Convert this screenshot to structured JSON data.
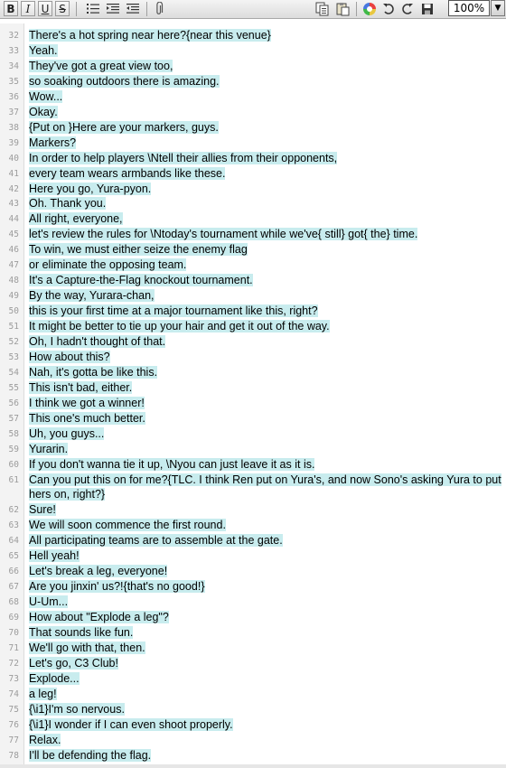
{
  "toolbar": {
    "buttons": [
      {
        "name": "bold-button",
        "icon": "bold-icon",
        "glyph": "B"
      },
      {
        "name": "italic-button",
        "icon": "italic-icon",
        "glyph": "I"
      },
      {
        "name": "underline-button",
        "icon": "underline-icon",
        "glyph": "U"
      },
      {
        "name": "strikeout-button",
        "icon": "strikeout-icon",
        "glyph": "S"
      },
      {
        "name": "list-button",
        "icon": "list-icon"
      },
      {
        "name": "indent-button",
        "icon": "indent-icon"
      },
      {
        "name": "outdent-button",
        "icon": "outdent-icon"
      },
      {
        "name": "attach-button",
        "icon": "paperclip-icon"
      },
      {
        "name": "copy-button",
        "icon": "copy-icon"
      },
      {
        "name": "paste-button",
        "icon": "paste-icon"
      },
      {
        "name": "color-button",
        "icon": "color-wheel-icon"
      },
      {
        "name": "undo-button",
        "icon": "undo-icon"
      },
      {
        "name": "redo-button",
        "icon": "redo-icon"
      },
      {
        "name": "save-button",
        "icon": "save-icon"
      }
    ],
    "zoom": "100%"
  },
  "colors": {
    "highlight": "#c8ecee",
    "line_number": "#9b9b9b"
  },
  "lines": [
    {
      "n": "32",
      "t": "There's a hot spring near here?{near this venue}"
    },
    {
      "n": "33",
      "t": "Yeah."
    },
    {
      "n": "34",
      "t": "They've got a great view too,"
    },
    {
      "n": "35",
      "t": "so soaking outdoors there is amazing."
    },
    {
      "n": "36",
      "t": "Wow..."
    },
    {
      "n": "37",
      "t": "Okay."
    },
    {
      "n": "38",
      "t": "{Put on }Here are your markers, guys."
    },
    {
      "n": "39",
      "t": "Markers?"
    },
    {
      "n": "40",
      "t": "In order to help players \\Ntell their allies from their opponents,"
    },
    {
      "n": "41",
      "t": "every team wears armbands like these."
    },
    {
      "n": "42",
      "t": "Here you go, Yura-pyon."
    },
    {
      "n": "43",
      "t": "Oh. Thank you."
    },
    {
      "n": "44",
      "t": "All right, everyone,"
    },
    {
      "n": "45",
      "t": "let's review the rules for \\Ntoday's tournament while we've{ still} got{ the} time."
    },
    {
      "n": "46",
      "t": "To win, we must either seize the enemy flag"
    },
    {
      "n": "47",
      "t": "or eliminate the opposing team."
    },
    {
      "n": "48",
      "t": "It's a Capture-the-Flag knockout tournament."
    },
    {
      "n": "49",
      "t": "By the way, Yurara-chan,"
    },
    {
      "n": "50",
      "t": "this is your first time at a major tournament like this, right?"
    },
    {
      "n": "51",
      "t": "It might be better to tie up your hair and get it out of the way."
    },
    {
      "n": "52",
      "t": "Oh, I hadn't thought of that."
    },
    {
      "n": "53",
      "t": "How about this?"
    },
    {
      "n": "54",
      "t": "Nah, it's gotta be like this."
    },
    {
      "n": "55",
      "t": "This isn't bad, either."
    },
    {
      "n": "56",
      "t": "I think we got a winner!"
    },
    {
      "n": "57",
      "t": "This one's much better."
    },
    {
      "n": "58",
      "t": "Uh, you guys..."
    },
    {
      "n": "59",
      "t": "Yurarin."
    },
    {
      "n": "60",
      "t": "If you don't wanna tie it up, \\Nyou can just leave it as it is."
    },
    {
      "n": "61",
      "t": "Can you put this on for me?{TLC. I think Ren put on Yura's, and now Sono's asking Yura to put hers on, right?}"
    },
    {
      "n": "62",
      "t": "Sure!"
    },
    {
      "n": "63",
      "t": "We will soon commence the first round."
    },
    {
      "n": "64",
      "t": "All participating teams are to assemble at the gate."
    },
    {
      "n": "65",
      "t": "Hell yeah!"
    },
    {
      "n": "66",
      "t": "Let's break a leg, everyone!"
    },
    {
      "n": "67",
      "t": "Are you jinxin' us?!{that's no good!}"
    },
    {
      "n": "68",
      "t": "U-Um..."
    },
    {
      "n": "69",
      "t": "How about \"Explode a leg\"?"
    },
    {
      "n": "70",
      "t": "That sounds like fun."
    },
    {
      "n": "71",
      "t": "We'll go with that, then."
    },
    {
      "n": "72",
      "t": "Let's go, C3 Club!"
    },
    {
      "n": "73",
      "t": "Explode..."
    },
    {
      "n": "74",
      "t": "a leg!"
    },
    {
      "n": "75",
      "t": "{\\i1}I'm so nervous."
    },
    {
      "n": "76",
      "t": "{\\i1}I wonder if I can even shoot properly."
    },
    {
      "n": "77",
      "t": "Relax."
    },
    {
      "n": "78",
      "t": "I'll be defending the flag."
    }
  ]
}
